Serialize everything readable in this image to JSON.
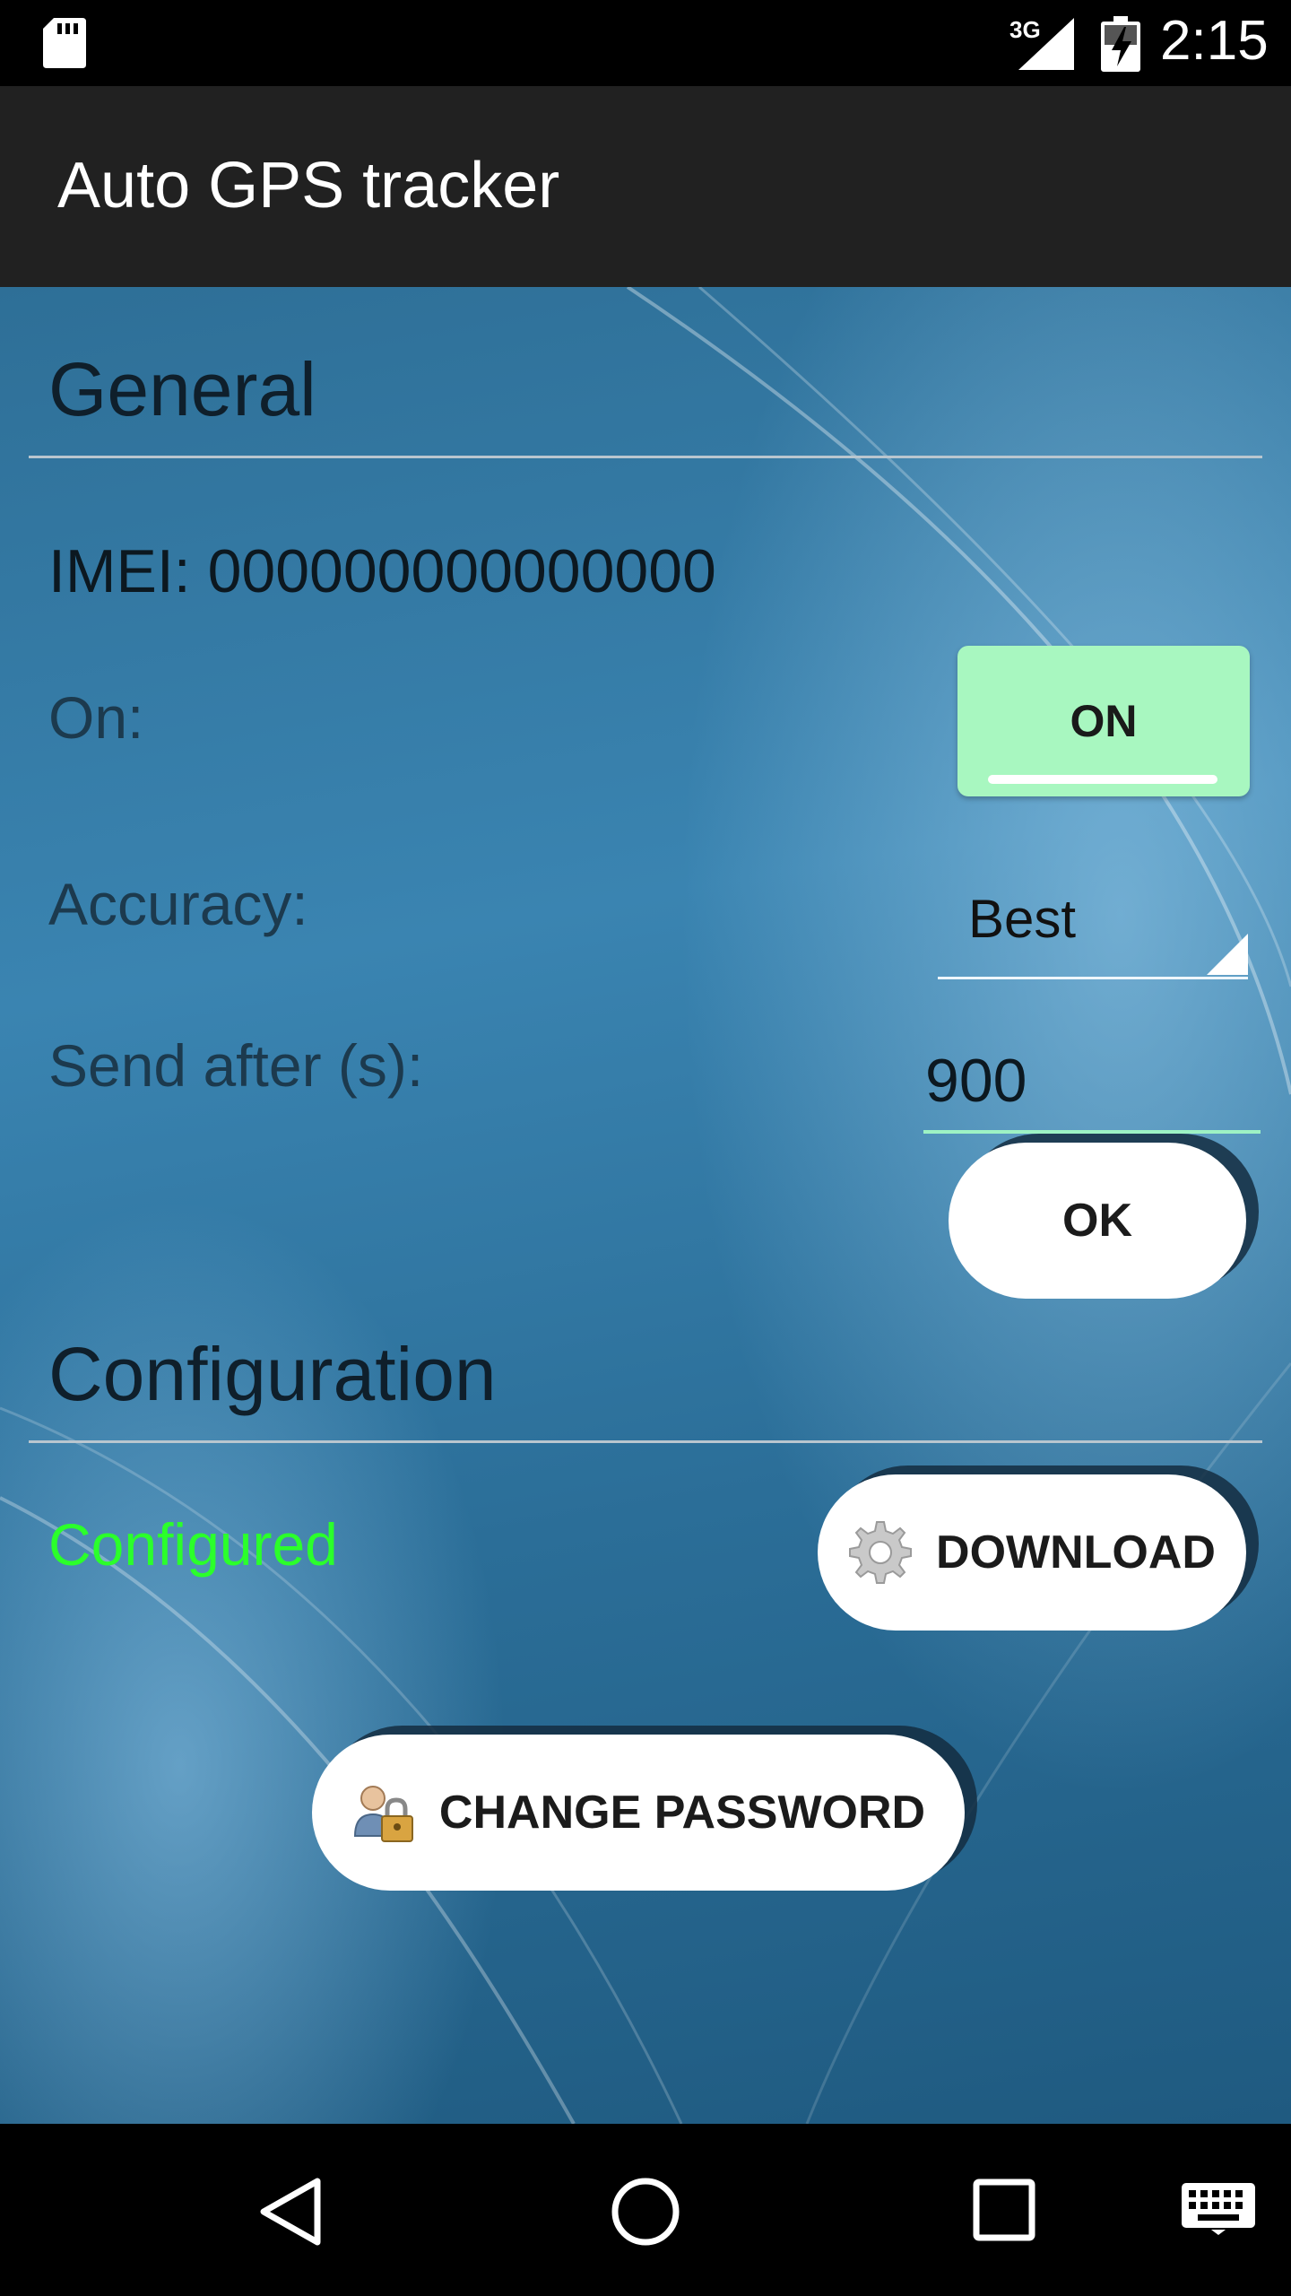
{
  "status_bar": {
    "network": "3G",
    "time": "2:15",
    "icons": [
      "sd-card-icon",
      "signal-icon",
      "battery-charging-icon"
    ]
  },
  "app_bar": {
    "title": "Auto GPS tracker"
  },
  "general": {
    "title": "General",
    "imei": "IMEI: 000000000000000",
    "on_label": "On:",
    "on_toggle": "ON",
    "accuracy_label": "Accuracy:",
    "accuracy_value": "Best",
    "send_after_label": "Send after (s):",
    "send_after_value": "900",
    "ok_button": "OK"
  },
  "configuration": {
    "title": "Configuration",
    "status": "Configured",
    "download_button": "DOWNLOAD",
    "change_password_button": "CHANGE PASSWORD"
  },
  "colors": {
    "app_bar": "#212121",
    "toggle_on": "#a8f7c0",
    "configured_text": "#2bff2b",
    "background_blue": "#2e6f97"
  },
  "nav_bar": {
    "icons": [
      "back-icon",
      "home-icon",
      "recents-icon",
      "keyboard-icon"
    ]
  }
}
